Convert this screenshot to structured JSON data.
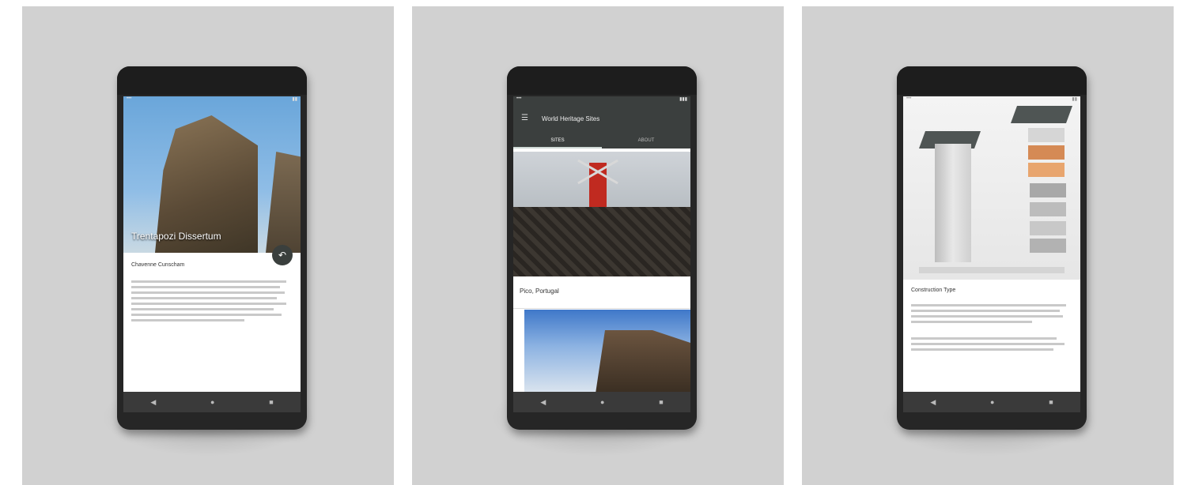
{
  "phones": [
    {
      "hero_title": "Trentapozi Dissertum",
      "section_heading": "Chavenne Cunscham",
      "fab_icon": "back-arrow-icon"
    },
    {
      "app_title": "World Heritage Sites",
      "tabs": [
        "SITES",
        "ABOUT"
      ],
      "card_title": "Pico, Portugal",
      "menu_icon": "hamburger-menu-icon"
    },
    {
      "section_heading": "Construction Type",
      "caption": ""
    }
  ],
  "navbar": {
    "back": "◀",
    "home": "●",
    "recents": "■"
  }
}
